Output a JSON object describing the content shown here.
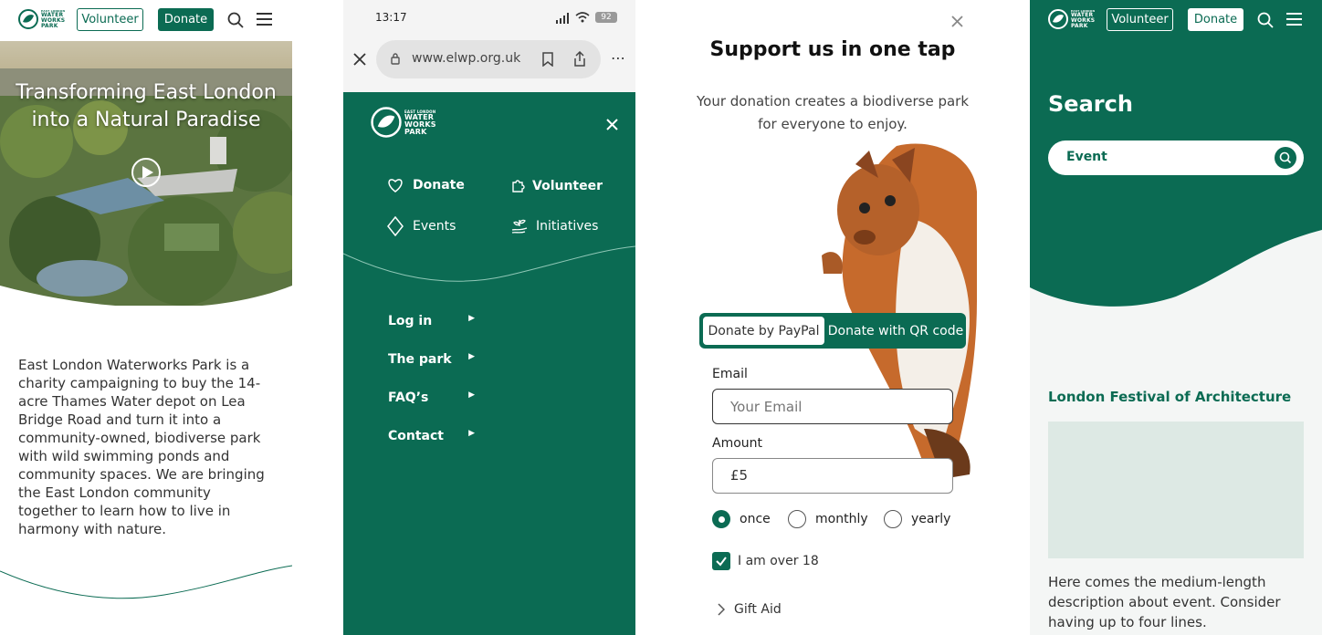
{
  "panel1": {
    "header": {
      "logo_top": "EAST LONDON",
      "logo_line1": "WATER",
      "logo_line2": "WORKS",
      "logo_line3": "PARK",
      "volunteer": "Volunteer",
      "donate": "Donate"
    },
    "hero": {
      "line1": "Transforming East London",
      "line2": "into a Natural Paradise"
    },
    "body_text": "East London Waterworks Park is a charity campaigning to buy the 14-acre Thames Water depot on Lea Bridge Road and turn it into a community-owned, biodiverse park with wild swimming ponds and community spaces. We are bringing the East London community together to learn how to live in harmony with nature."
  },
  "panel2": {
    "status": {
      "time": "13:17",
      "battery": "92"
    },
    "browser": {
      "url": "www.elwp.org.uk"
    },
    "menu": {
      "logo_top": "EAST LONDON",
      "logo_line1": "WATER",
      "logo_line2": "WORKS",
      "logo_line3": "PARK",
      "quick": [
        {
          "label": "Donate",
          "icon": "heart-icon"
        },
        {
          "label": "Volunteer",
          "icon": "puzzle-icon"
        },
        {
          "label": "Events",
          "icon": "diamond-icon"
        },
        {
          "label": "Initiatives",
          "icon": "hands-plant-icon"
        }
      ],
      "links": [
        "Log in",
        "The park",
        "FAQ’s",
        "Contact"
      ]
    }
  },
  "panel3": {
    "title": "Support us in one tap",
    "subtitle_line1": "Your donation creates a biodiverse park",
    "subtitle_line2": "for everyone to enjoy.",
    "tabs": [
      "Donate by PayPal",
      "Donate with QR code"
    ],
    "email_label": "Email",
    "email_placeholder": "Your Email",
    "amount_label": "Amount",
    "amount_value": "£5",
    "frequency": [
      "once",
      "monthly",
      "yearly"
    ],
    "selected_frequency": "once",
    "age_check": "I am over 18",
    "gift_aid": "Gift Aid"
  },
  "panel4": {
    "header": {
      "logo_top": "EAST LONDON",
      "logo_line1": "WATER",
      "logo_line2": "WORKS",
      "logo_line3": "PARK",
      "volunteer": "Volunteer",
      "donate": "Donate"
    },
    "search_title": "Search",
    "search_value": "Event",
    "result_title": "London Festival of Architecture",
    "result_desc": "Here comes the medium-length description about event. Consider having up to four lines."
  },
  "colors": {
    "brand_green": "#0b6b53",
    "placeholder_tile": "#dde9e4"
  }
}
